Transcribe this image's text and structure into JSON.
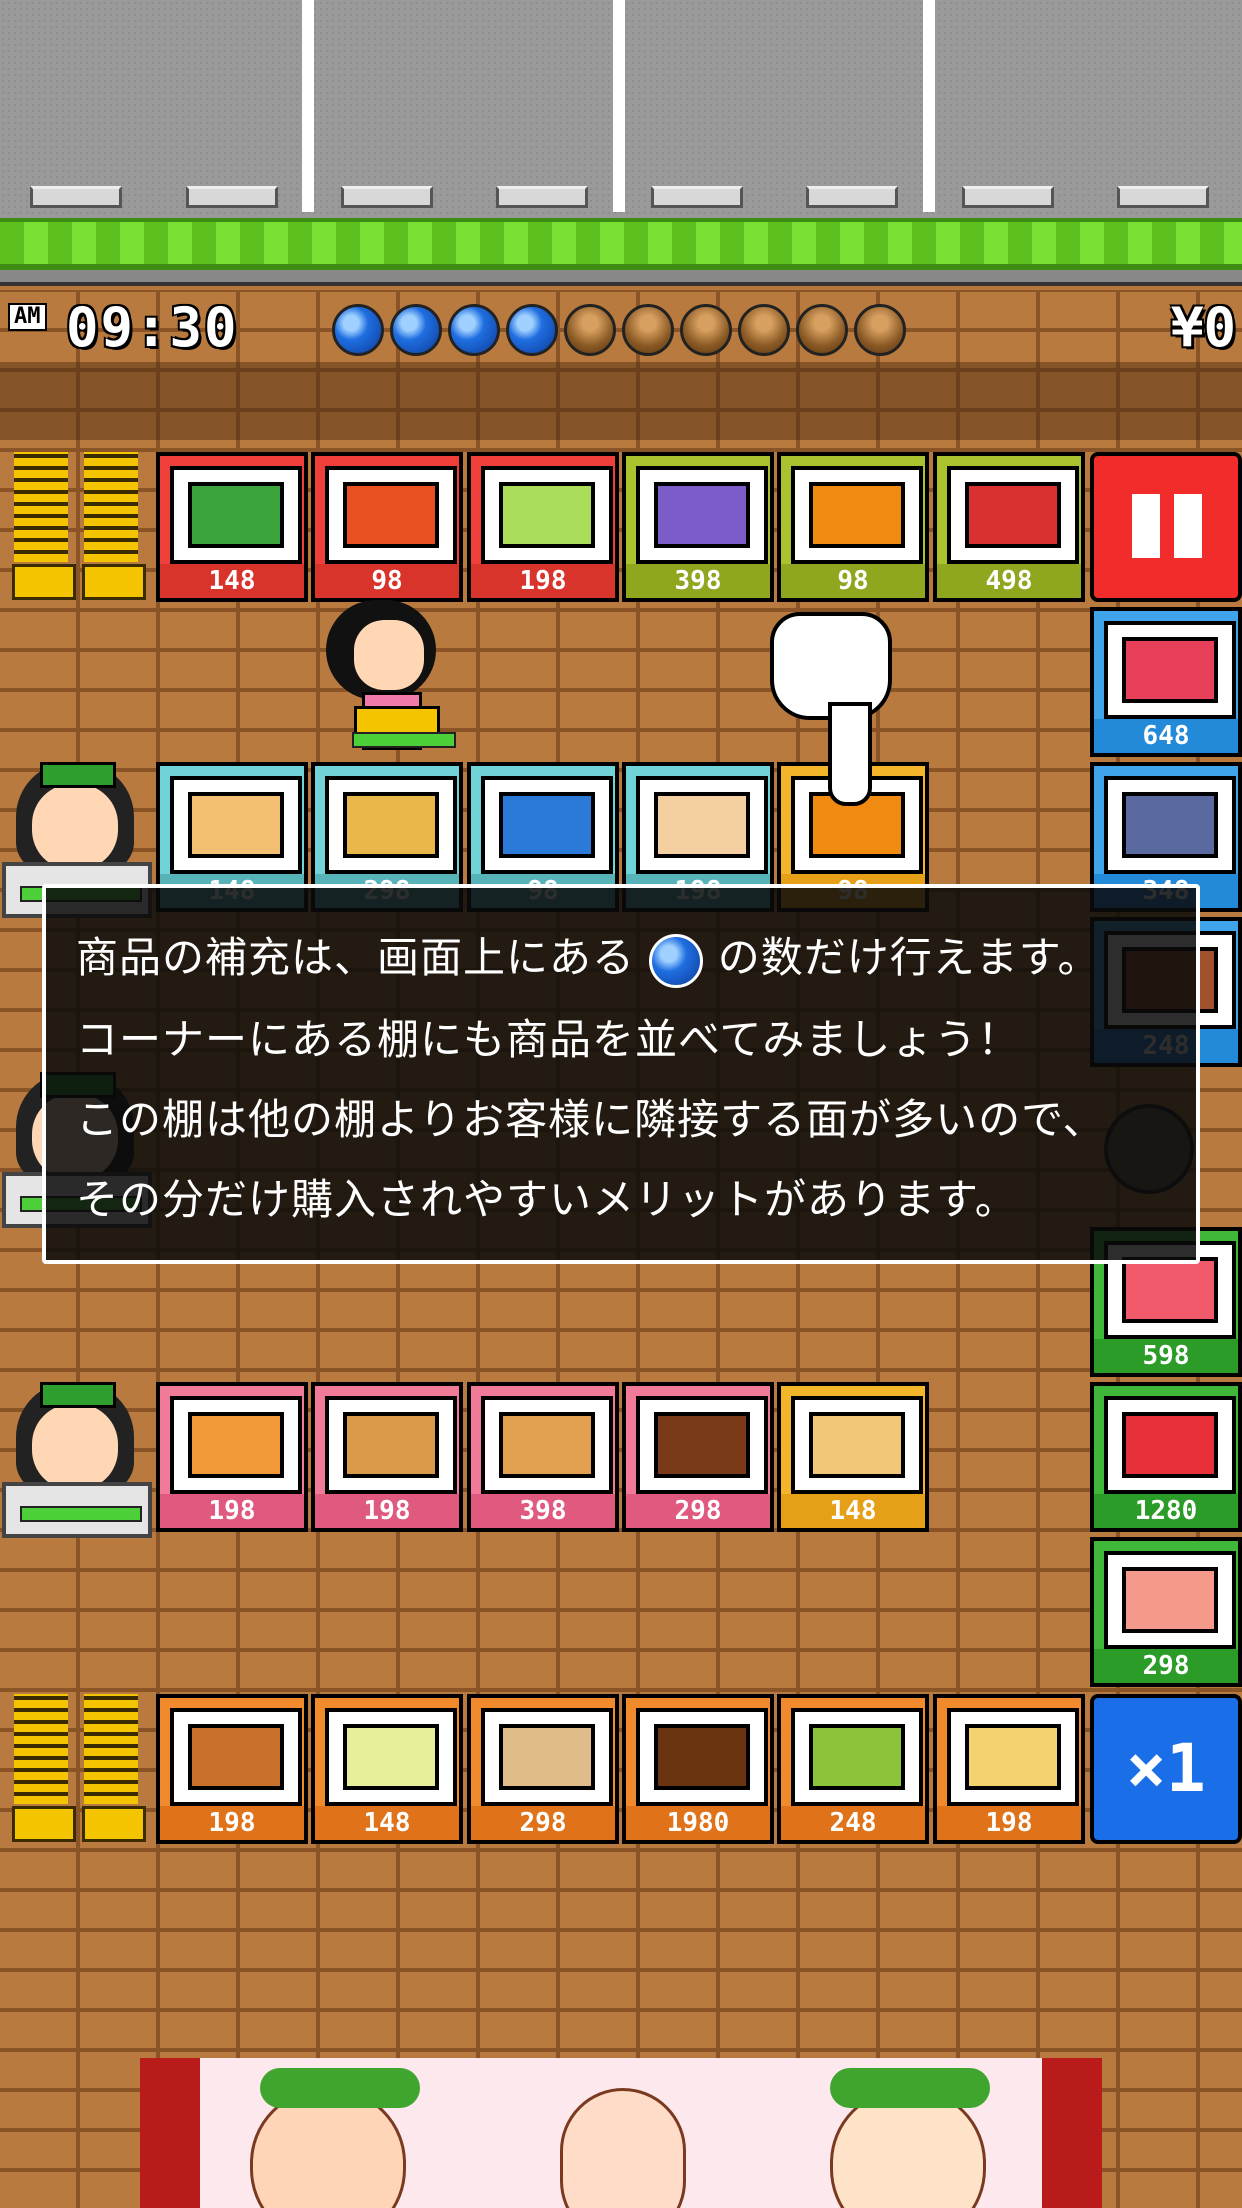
{
  "hud": {
    "ampm": "AM",
    "time": "09:30",
    "money": "¥0",
    "orbs_full": 4,
    "orbs_total": 10
  },
  "shelves": {
    "top_row": [
      {
        "item": "watermelon-icon",
        "price": "148"
      },
      {
        "item": "carrot-icon",
        "price": "98"
      },
      {
        "item": "cabbage-icon",
        "price": "198"
      },
      {
        "item": "grapes-icon",
        "price": "398"
      },
      {
        "item": "orange-icon",
        "price": "98"
      },
      {
        "item": "strawberry-pack-icon",
        "price": "498"
      }
    ],
    "row2": [
      {
        "item": "bread-icon",
        "price": "148"
      },
      {
        "item": "bun-icon",
        "price": "298"
      },
      {
        "item": "milk-icon",
        "price": "98"
      },
      {
        "item": "toast-icon",
        "price": "198"
      },
      {
        "item": "orange-icon",
        "price": "98"
      }
    ],
    "row3": [
      {
        "item": "cake-slice-icon",
        "price": "198"
      },
      {
        "item": "pizza-icon",
        "price": "198"
      },
      {
        "item": "pancake-icon",
        "price": "398"
      },
      {
        "item": "chocolate-icon",
        "price": "298"
      },
      {
        "item": "cracker-icon",
        "price": "148"
      }
    ],
    "row4": [
      {
        "item": "croquette-icon",
        "price": "198"
      },
      {
        "item": "salad-icon",
        "price": "148"
      },
      {
        "item": "bread-roll-icon",
        "price": "298"
      },
      {
        "item": "chocolate-bar-icon",
        "price": "1980"
      },
      {
        "item": "matcha-icon",
        "price": "248"
      },
      {
        "item": "beer-icon",
        "price": "198"
      }
    ],
    "right_column": [
      {
        "item": "meat-icon",
        "price": "648"
      },
      {
        "item": "fish-icon",
        "price": "348"
      },
      {
        "item": "sausage-icon",
        "price": "248"
      },
      {
        "item": "tuna-icon",
        "price": "598"
      },
      {
        "item": "beef-icon",
        "price": "1280"
      },
      {
        "item": "salmon-icon",
        "price": "298"
      }
    ]
  },
  "buttons": {
    "pause": "pause-icon",
    "speed": "×1"
  },
  "dialog": {
    "line1_a": "商品の補充は、画面上にある",
    "line1_b": "の数だけ行えます。",
    "line2": "コーナーにある棚にも商品を並べてみましょう！",
    "line3": "この棚は他の棚よりお客様に隣接する面が多いので、",
    "line4": "その分だけ購入されやすいメリットがあります。"
  },
  "colors": {
    "orb_full": "#1f6ee0",
    "pause_red": "#f22b2b",
    "speed_blue": "#1a6fe8",
    "grass": "#6fd12a"
  }
}
